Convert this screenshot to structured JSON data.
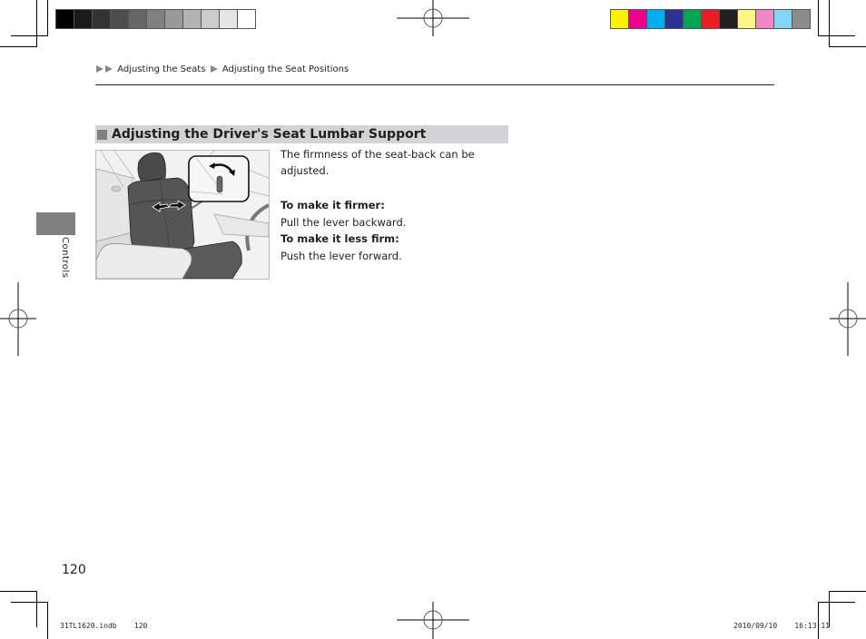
{
  "color_bars": {
    "grayscale": [
      "#000000",
      "#1a1a1a",
      "#333333",
      "#4d4d4d",
      "#666666",
      "#808080",
      "#999999",
      "#b3b3b3",
      "#cccccc",
      "#e6e6e6",
      "#ffffff"
    ],
    "process": [
      "#fff200",
      "#ec008c",
      "#00aeef",
      "#2e3192",
      "#00a651",
      "#ed1c24",
      "#231f20",
      "#fff685",
      "#f386c4",
      "#7fd6f6",
      "#8c8c8c"
    ]
  },
  "breadcrumb": {
    "items": [
      "Adjusting the Seats",
      "Adjusting the Seat Positions"
    ]
  },
  "section": {
    "title": "Adjusting the Driver's Seat Lumbar Support"
  },
  "side_tab": {
    "label": "Controls"
  },
  "illustration": {
    "description": "Driver's seat with lumbar support lever callout"
  },
  "body": {
    "intro": "The firmness of the seat-back can be adjusted.",
    "firmer_heading": "To make it firmer:",
    "firmer_text": "Pull the lever backward.",
    "less_firm_heading": "To make it less firm:",
    "less_firm_text": "Push the lever forward."
  },
  "page_number": "120",
  "footer": {
    "file": "31TL1620.indb    120",
    "timestamp": "2010/09/10    16:13:11"
  }
}
